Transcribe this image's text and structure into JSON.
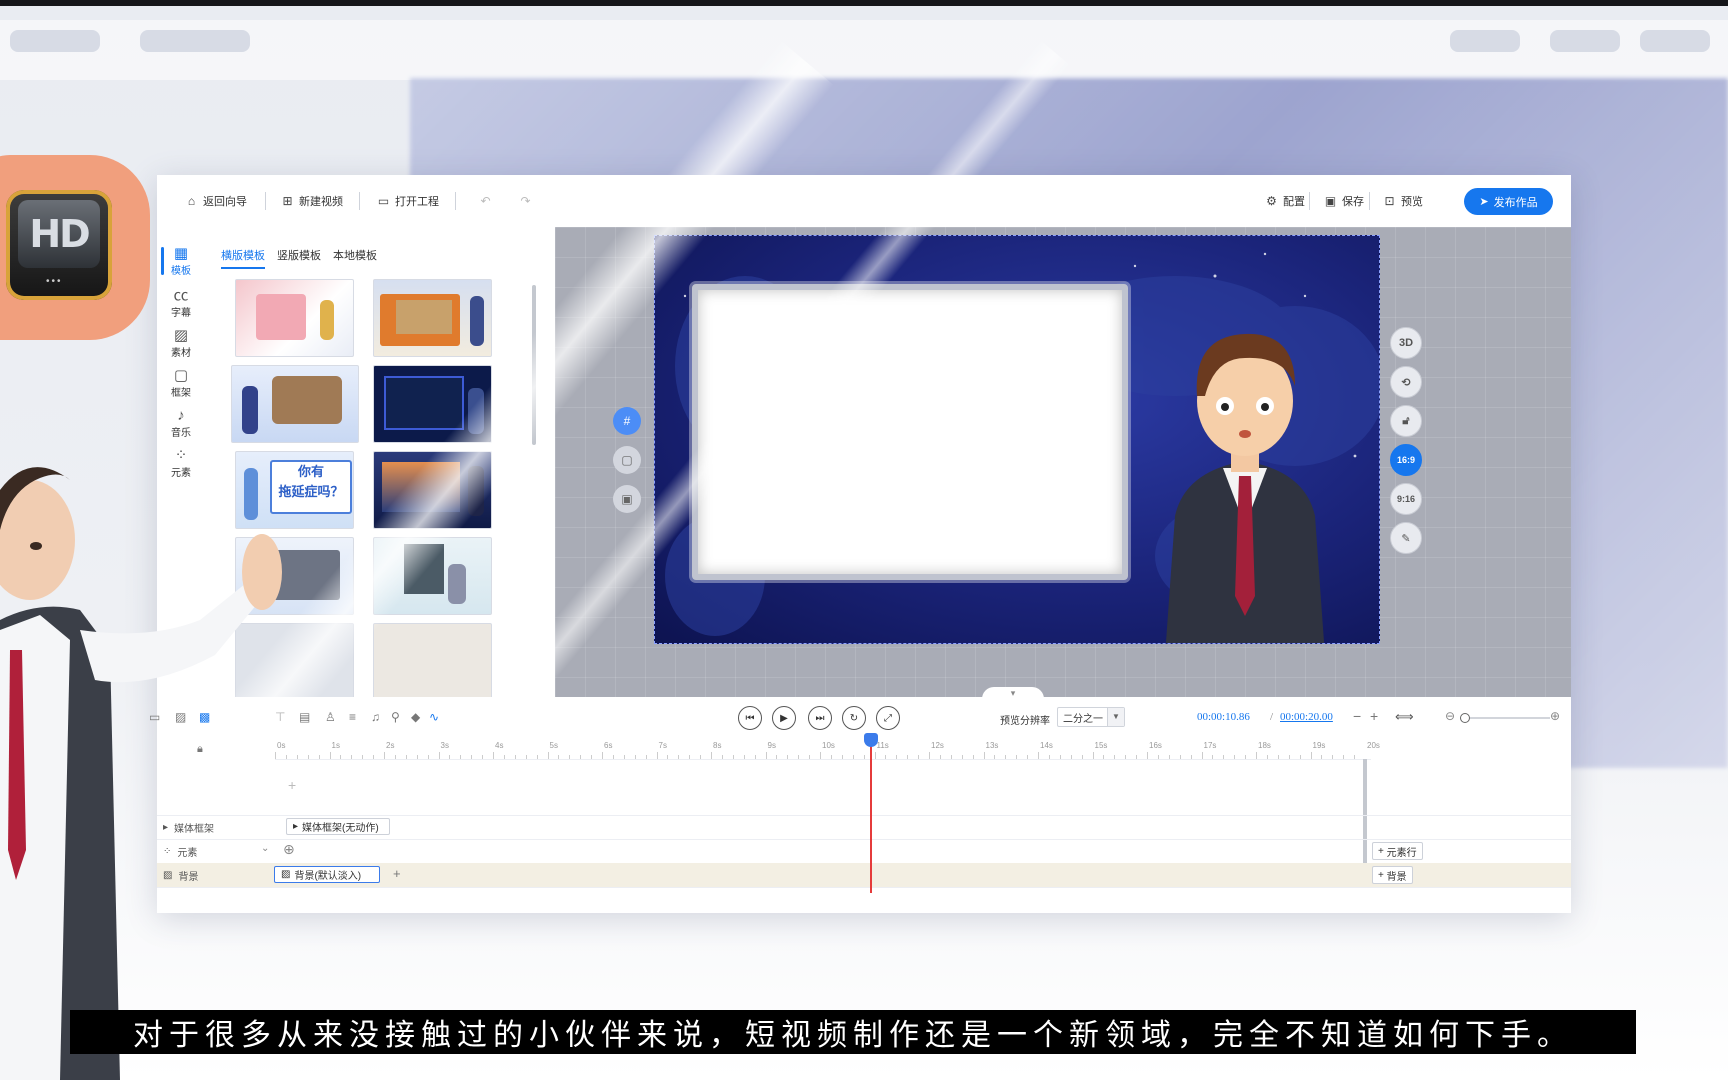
{
  "toolbar": {
    "back": "返回向导",
    "new_video": "新建视频",
    "open_project": "打开工程",
    "config": "配置",
    "save": "保存",
    "preview": "预览",
    "publish": "发布作品"
  },
  "rail": [
    {
      "label": "模板",
      "icon": "template-icon"
    },
    {
      "label": "字幕",
      "icon": "caption-icon"
    },
    {
      "label": "素材",
      "icon": "image-icon"
    },
    {
      "label": "框架",
      "icon": "frame-icon"
    },
    {
      "label": "音乐",
      "icon": "music-icon"
    },
    {
      "label": "元素",
      "icon": "element-icon"
    }
  ],
  "panel": {
    "tabs": [
      "横版模板",
      "竖版模板",
      "本地模板"
    ],
    "thumb_text": {
      "line1": "你有",
      "line2": "拖延症吗？"
    }
  },
  "stage": {
    "right_buttons": [
      "3D",
      "",
      "",
      "16:9",
      "9:16",
      ""
    ]
  },
  "player": {
    "resolution_label": "预览分辨率",
    "resolution_value": "二分之一",
    "current_time": "00:00:10.86",
    "divider": "/",
    "total_time": "00:00:20.00",
    "minus": "−",
    "plus": "+"
  },
  "timeline": {
    "ticks": [
      "0s",
      "1s",
      "2s",
      "3s",
      "4s",
      "5s",
      "6s",
      "7s",
      "8s",
      "9s",
      "10s",
      "11s",
      "12s",
      "13s",
      "14s",
      "15s",
      "16s",
      "17s",
      "18s",
      "19s",
      "20s"
    ],
    "tracks": {
      "media_frame": "媒体框架",
      "elements": "元素",
      "background": "背景"
    },
    "clips": {
      "media_frame": "媒体框架(无动作)",
      "background": "背景(默认淡入)"
    },
    "right_buttons": {
      "element_row": "元素行",
      "background": "背景"
    }
  },
  "subtitle": "对于很多从来没接触过的小伙伴来说，短视频制作还是一个新领域，完全不知道如何下手。",
  "colors": {
    "accent": "#1677ee",
    "playhead": "#e53b3b",
    "video_bg": "#1a2378"
  }
}
